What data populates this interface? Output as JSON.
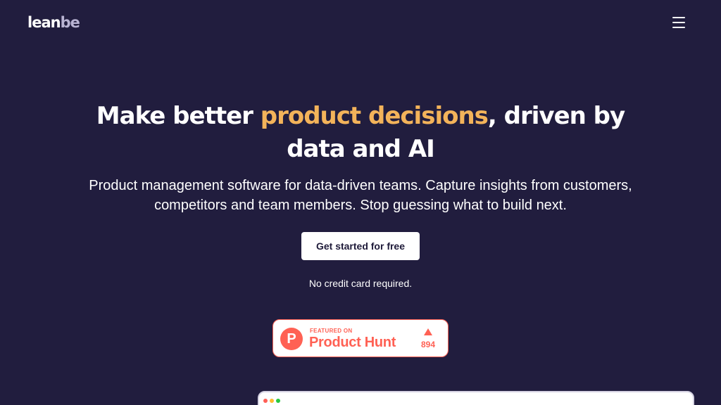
{
  "header": {
    "logo_primary": "lean",
    "logo_secondary": "be",
    "menu_icon": "hamburger-menu-icon"
  },
  "hero": {
    "headline_before": "Make better ",
    "headline_accent": "product decisions",
    "headline_after": ", driven by data and AI",
    "subtitle": "Product management software for data-driven teams. Capture insights from customers, competitors and team members. Stop guessing what to build next.",
    "cta_label": "Get started for free",
    "note": "No credit card required."
  },
  "product_hunt": {
    "featured_label": "FEATURED ON",
    "name": "Product Hunt",
    "logo_letter": "P",
    "upvotes": "894"
  },
  "colors": {
    "background": "#211d3e",
    "accent": "#f3b35a",
    "product_hunt": "#ff6154"
  }
}
